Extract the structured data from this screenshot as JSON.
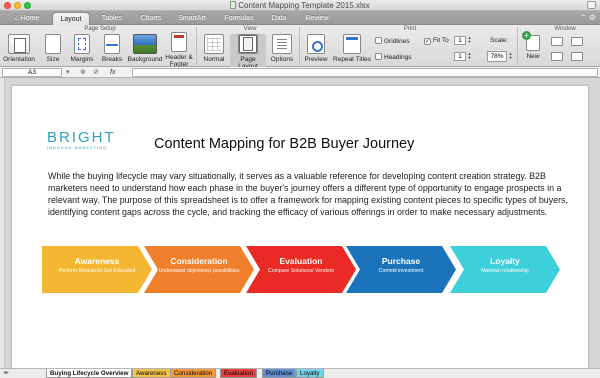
{
  "window": {
    "title": "Content Mapping Template 2015.xlsx"
  },
  "ribbon_tabs": [
    "Home",
    "Layout",
    "Tables",
    "Charts",
    "SmartArt",
    "Formulas",
    "Data",
    "Review"
  ],
  "active_tab": "Layout",
  "groups": {
    "page_setup": "Page Setup",
    "view": "View",
    "print": "Print",
    "window": "Window"
  },
  "buttons": {
    "orientation": "Orientation",
    "size": "Size",
    "margins": "Margins",
    "breaks": "Breaks",
    "background": "Background",
    "header_footer_1": "Header &",
    "header_footer_2": "Footer",
    "normal": "Normal",
    "page_layout": "Page Layout",
    "options": "Options",
    "preview": "Preview",
    "repeat_titles": "Repeat Titles",
    "new": "New"
  },
  "print": {
    "gridlines": "Gridlines",
    "headings": "Headings",
    "fit_to": "Fit To",
    "fit_to_checked": true,
    "fit_width": "1",
    "fit_height": "1",
    "scale_label": "Scale:",
    "scale_value": "78%"
  },
  "formula_bar": {
    "cell_ref": "A3",
    "fx": "fx",
    "value": ""
  },
  "document": {
    "logo": "BRIGHT",
    "logo_tagline": "INBOUND MARKETING",
    "title": "Content Mapping for B2B Buyer Journey",
    "intro": "While the buying lifecycle may vary situationally, it serves as a valuable reference for developing content creation strategy. B2B marketers need to understand how each phase in the buyer's journey  offers a different type of opportunity to engage prospects in a relevant way. The purpose of this spreadsheet is to offer a framework for mapping  existing content pieces to specific types of buyers, identifying content gaps across the cycle, and tracking the efficacy of various offerings in order to make necessary adjustments.",
    "stages": [
      {
        "title": "Awareness",
        "subtitle": "Perform Research/ Get Educated",
        "color": "#f5b731"
      },
      {
        "title": "Consideration",
        "subtitle": "Understand objectives/ possibilities",
        "color": "#f1802c"
      },
      {
        "title": "Evaluation",
        "subtitle": "Compare Solutions/ Vendors",
        "color": "#ea2a24"
      },
      {
        "title": "Purchase",
        "subtitle": "Commit investment",
        "color": "#1a73bb"
      },
      {
        "title": "Loyalty",
        "subtitle": "Maintain relationship",
        "color": "#3ed0da"
      }
    ]
  },
  "sheet_tabs": [
    {
      "label": "Buying Lifecycle Overview",
      "color": "#ffffff"
    },
    {
      "label": "Awareness",
      "color": "#f5c34a"
    },
    {
      "label": "Consideration",
      "color": "#f59a3c"
    },
    {
      "label": "Evaluation",
      "color": "#e8403a"
    },
    {
      "label": "Purchase",
      "color": "#5f8fd0"
    },
    {
      "label": "Loyalty",
      "color": "#7ad3ea"
    }
  ]
}
